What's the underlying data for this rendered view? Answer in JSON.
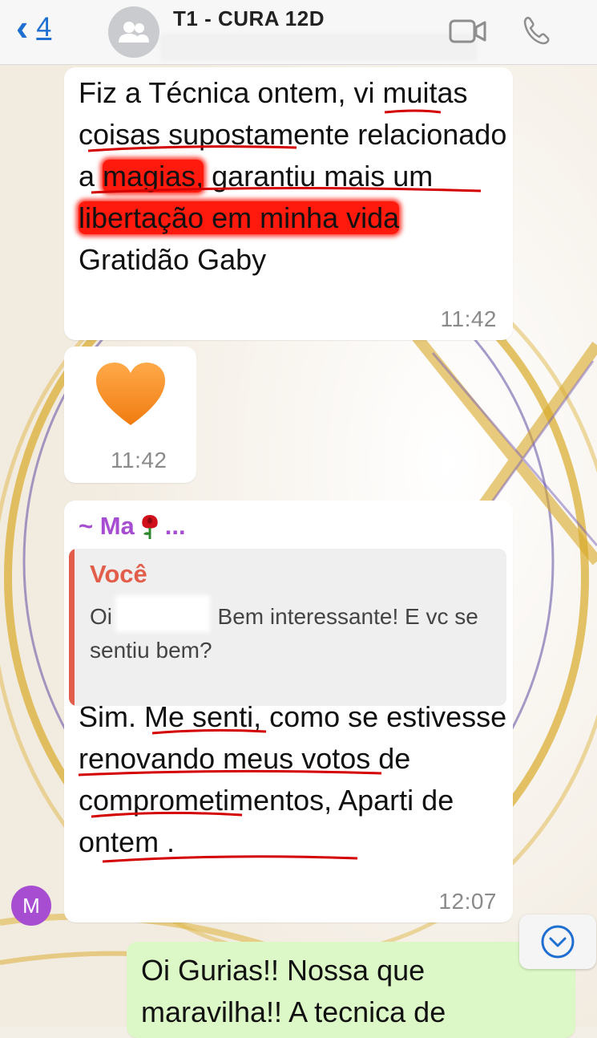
{
  "header": {
    "back_count": "4",
    "title": "T1 - CURA 12D",
    "icons": [
      "chevron-left-icon",
      "group-avatar-icon",
      "video-call-icon",
      "phone-icon"
    ]
  },
  "messages": [
    {
      "text_parts": [
        "Fiz a Técnica ontem, ",
        "vi",
        " ",
        "muitas coisas",
        " ",
        "supostamente relacionado",
        " a ",
        "magias,",
        " garantiu mais um ",
        "libertação em minha vida",
        " Gratidão Gaby"
      ],
      "time": "11:42"
    },
    {
      "emoji": "orange-heart",
      "time": "11:42"
    },
    {
      "sender": "~ Ma",
      "sender_suffix": "...",
      "sender_emoji": "rose-icon",
      "quoted": {
        "name": "Você",
        "text_prefix": "Oi ",
        "text_rest": " Bem interessante! E vc se sentiu bem?"
      },
      "text_parts": [
        "Sim. ",
        "Me senti",
        ", como se ",
        "estivesse renovando",
        " meus ",
        "votos de",
        " ",
        "comprometimentos",
        ", Aparti de ontem ."
      ],
      "time": "12:07",
      "avatar_initial": "M"
    },
    {
      "text": "Oi Gurias!! Nossa que maravilha!! A tecnica de"
    }
  ],
  "colors": {
    "accent_blue": "#1f6fd0",
    "sender_purple": "#a64dd1",
    "quote_red": "#e25d4a",
    "outgoing_green": "#dcf8c6",
    "highlight_red": "#ff1a0d"
  }
}
